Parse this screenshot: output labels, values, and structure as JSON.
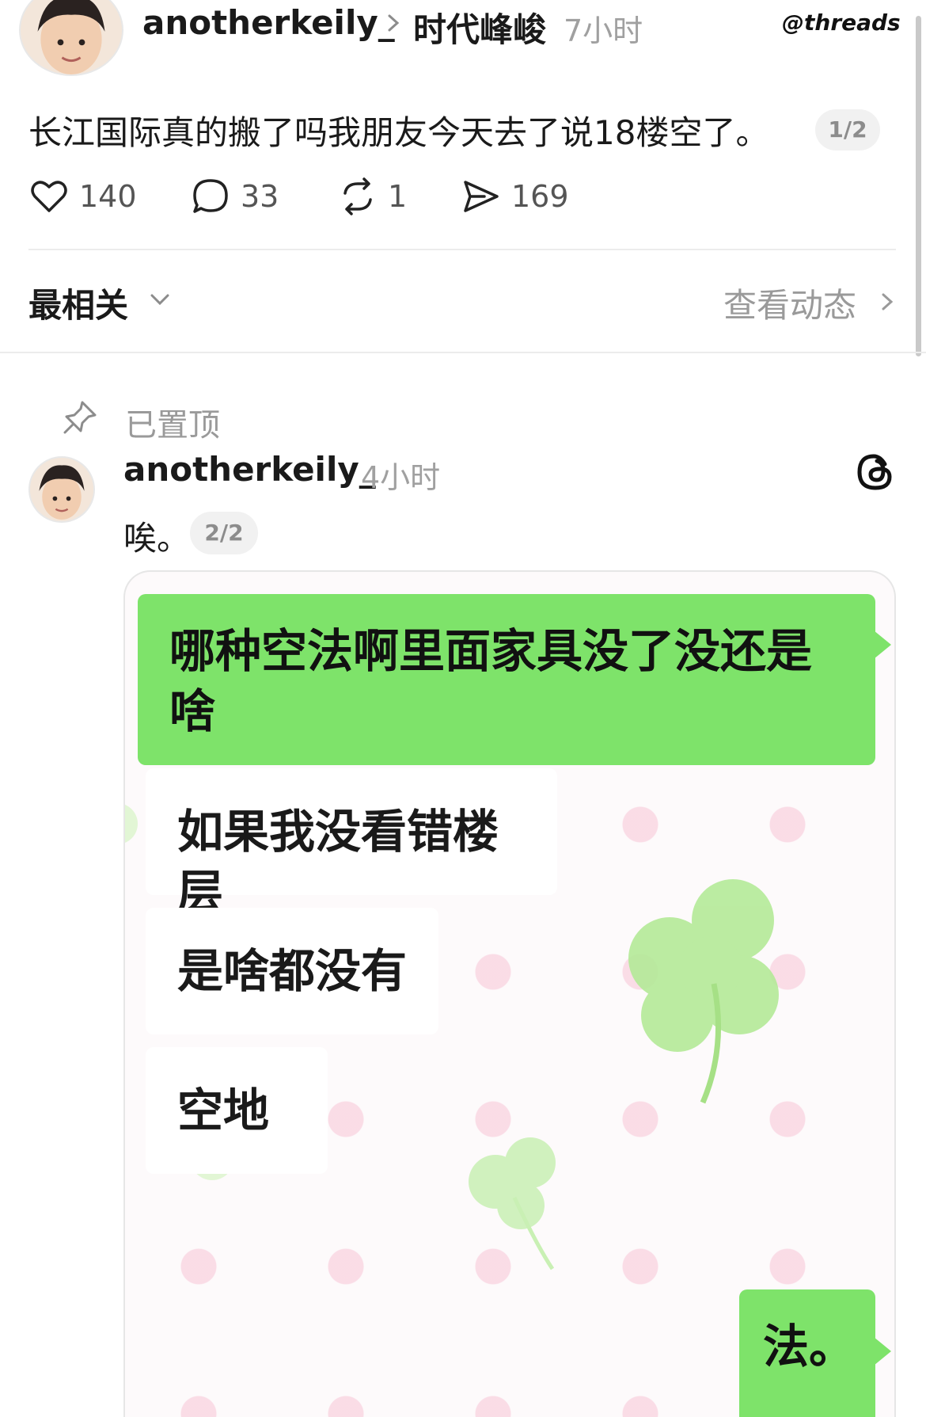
{
  "post": {
    "username": "anotherkeily_",
    "topic": "时代峰峻",
    "time": "7小时",
    "brand": "threads",
    "text": "长江国际真的搬了吗我朋友今天去了说18楼空了。",
    "page_indicator": "1/2",
    "actions": {
      "likes": "140",
      "replies": "33",
      "reposts": "1",
      "shares": "169"
    }
  },
  "sort": {
    "label": "最相关",
    "activity_link": "查看动态"
  },
  "reply": {
    "pinned_label": "已置顶",
    "username": "anotherkeily_",
    "time": "4小时",
    "text": "唉。",
    "page_indicator": "2/2",
    "chat": {
      "message_1": "哪种空法啊里面家具没了没还是啥",
      "message_2": "如果我没看错楼层",
      "message_3": "是啥都没有",
      "message_4": "空地",
      "message_5": "法。"
    }
  },
  "colors": {
    "chat_green": "#7ee36a",
    "muted_text": "#9a9a9a",
    "clover": "#a8e68a",
    "dot_pink": "#f8c4d6"
  },
  "icons": [
    "heart-icon",
    "reply-icon",
    "repost-icon",
    "share-icon",
    "chevron-down-icon",
    "chevron-right-icon",
    "pin-icon",
    "threads-logo-icon"
  ]
}
